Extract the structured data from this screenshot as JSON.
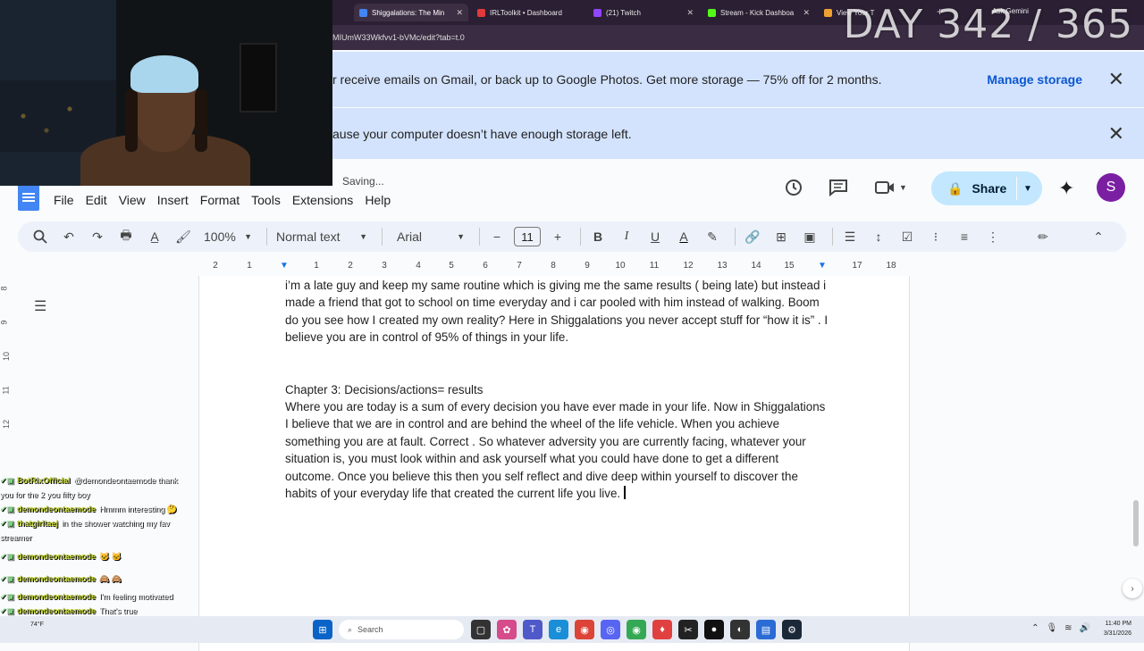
{
  "browser": {
    "tabs": [
      {
        "label": "Shiggalations: The Min",
        "color": "#4285f4",
        "active": true
      },
      {
        "label": "IRLToolkit • Dashboard",
        "color": "#e03a3a",
        "active": false
      },
      {
        "label": "(21) Twitch",
        "color": "#9146ff",
        "active": false
      },
      {
        "label": "Stream - Kick Dashboa",
        "color": "#53fc18",
        "active": false
      },
      {
        "label": "View Your T",
        "color": "#f0a030",
        "active": false
      }
    ],
    "ask_gemini": "Ask Gemini",
    "url": "MIUmW33Wkfvv1-bVMc/edit?tab=t.0"
  },
  "overlay": {
    "day_counter": "DAY 342 / 365"
  },
  "banners": [
    {
      "text": "r receive emails on Gmail, or back up to Google Photos. Get more storage — 75% off for 2 months.",
      "action": "Manage storage"
    },
    {
      "text": "ause your computer doesn’t have enough storage left."
    }
  ],
  "docs": {
    "status": "Saving...",
    "menu": [
      "File",
      "Edit",
      "View",
      "Insert",
      "Format",
      "Tools",
      "Extensions",
      "Help"
    ],
    "share_label": "Share",
    "avatar_letter": "S"
  },
  "toolbar": {
    "zoom": "100%",
    "style": "Normal text",
    "font": "Arial",
    "font_size": "11"
  },
  "ruler": {
    "marks": [
      "2",
      "1",
      "1",
      "2",
      "3",
      "4",
      "5",
      "6",
      "7",
      "8",
      "9",
      "10",
      "11",
      "12",
      "13",
      "14",
      "15",
      "16",
      "17",
      "18"
    ]
  },
  "vruler": {
    "marks": [
      "8",
      "9",
      "10",
      "11",
      "12"
    ]
  },
  "document": {
    "paragraphs": [
      "i’m a late guy and keep my same routine which is giving me the same results ( being late) but instead i made a friend that got to school on time everyday and i car pooled with him instead of walking. Boom do you see how I created my own reality? Here in Shiggalations you never accept stuff for “how it is” . I believe you are in control of 95% of things in your life.",
      "Chapter 3: Decisions/actions= results",
      " Where you are today is a sum of every decision you have ever made in your life. Now in Shiggalations I  believe that we are in control and are behind the wheel of the life vehicle. When you achieve something you are at fault. Correct . So whatever adversity you are currently facing, whatever your situation is, you must look within and ask yourself what you could have done to get a different outcome. Once you believe this then you self reflect and dive deep within yourself to discover the habits of your everyday life that created the current life you live."
    ]
  },
  "chat": [
    {
      "user": "BotRixOfficial",
      "msg": "@demondeontaemode thank"
    },
    {
      "user": "",
      "msg": "you for the 2 you fifty boy"
    },
    {
      "user": "demondeontaemode",
      "msg": "Hmmm interesting 🤔"
    },
    {
      "user": "thatgirltaej",
      "msg": "in the shower watching my fav"
    },
    {
      "user": "",
      "msg": "streamer"
    },
    {
      "user": "demondeontaemode",
      "msg": "🐱 🐱"
    },
    {
      "user": "demondeontaemode",
      "msg": "🙈 🙈"
    },
    {
      "user": "demondeontaemode",
      "msg": "I'm feeling motivated"
    },
    {
      "user": "demondeontaemode",
      "msg": "That's true"
    }
  ],
  "taskbar": {
    "search": "Search",
    "time": "11:40 PM",
    "date": "3/31/2026",
    "weather": "74°F"
  }
}
